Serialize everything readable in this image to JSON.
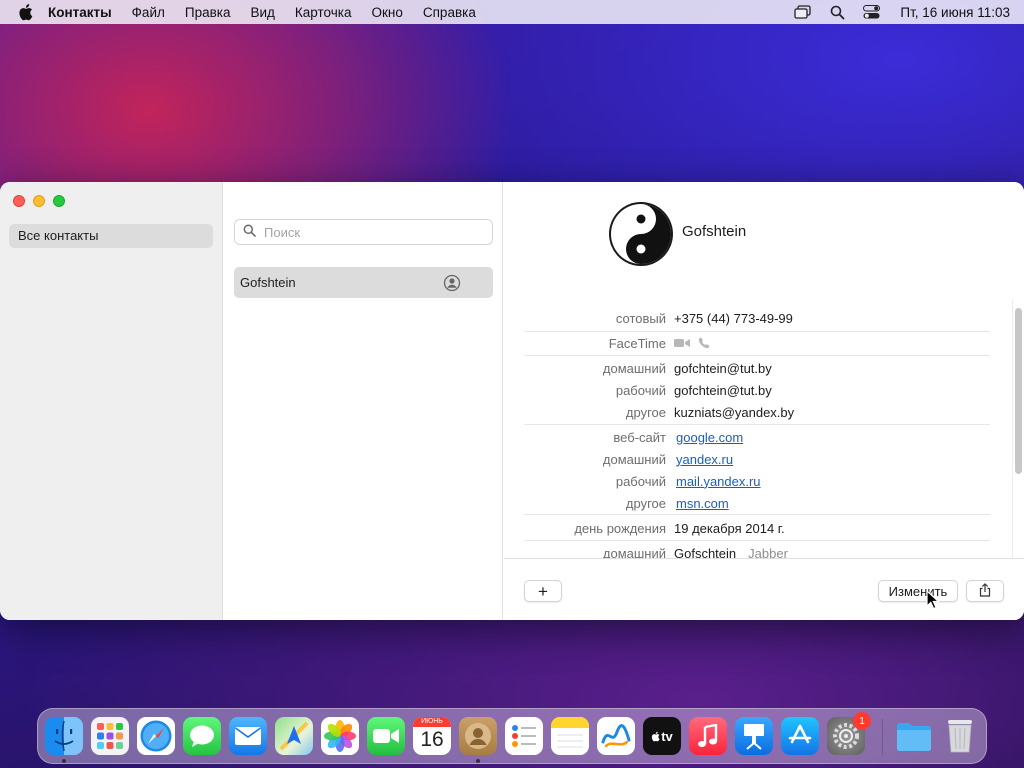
{
  "menubar": {
    "app_name": "Контакты",
    "items": [
      "Файл",
      "Правка",
      "Вид",
      "Карточка",
      "Окно",
      "Справка"
    ],
    "clock": "Пт, 16 июня  11:03"
  },
  "sidebar": {
    "group": "Все контакты"
  },
  "list": {
    "search_placeholder": "Поиск",
    "contacts": [
      "Gofshtein"
    ]
  },
  "detail": {
    "name": "Gofshtein",
    "fields": [
      {
        "label": "сотовый",
        "value": "+375 (44) 773-49-99"
      },
      {
        "label": "FaceTime",
        "value": ""
      },
      {
        "label": "домашний",
        "value": "gofchtein@tut.by"
      },
      {
        "label": "рабочий",
        "value": "gofchtein@tut.by"
      },
      {
        "label": "другое",
        "value": "kuzniats@yandex.by"
      },
      {
        "label": "веб-сайт",
        "value": "google.com"
      },
      {
        "label": "домашний",
        "value": "yandex.ru"
      },
      {
        "label": "рабочий",
        "value": "mail.yandex.ru"
      },
      {
        "label": "другое",
        "value": "msn.com"
      },
      {
        "label": "день рождения",
        "value": "19 декабря 2014 г."
      },
      {
        "label": "домашний",
        "value": "Gofschtein",
        "service": "Jabber"
      }
    ],
    "buttons": {
      "add": "+",
      "edit": "Изменить"
    }
  },
  "dock": {
    "calendar_month": "ИЮНЬ",
    "calendar_day": "16",
    "appletv_label": "tv",
    "settings_badge": "1",
    "apps": [
      "Finder",
      "Launchpad",
      "Safari",
      "Messages",
      "Mail",
      "Maps",
      "Photos",
      "FaceTime",
      "Calendar",
      "Contacts",
      "Reminders",
      "Notes",
      "Freeform",
      "TV",
      "Music",
      "Keynote",
      "App Store",
      "System Settings",
      "Downloads",
      "Trash"
    ]
  },
  "colors": {
    "accent_link": "#1a5fbf",
    "selection": "#dcdcdc"
  }
}
